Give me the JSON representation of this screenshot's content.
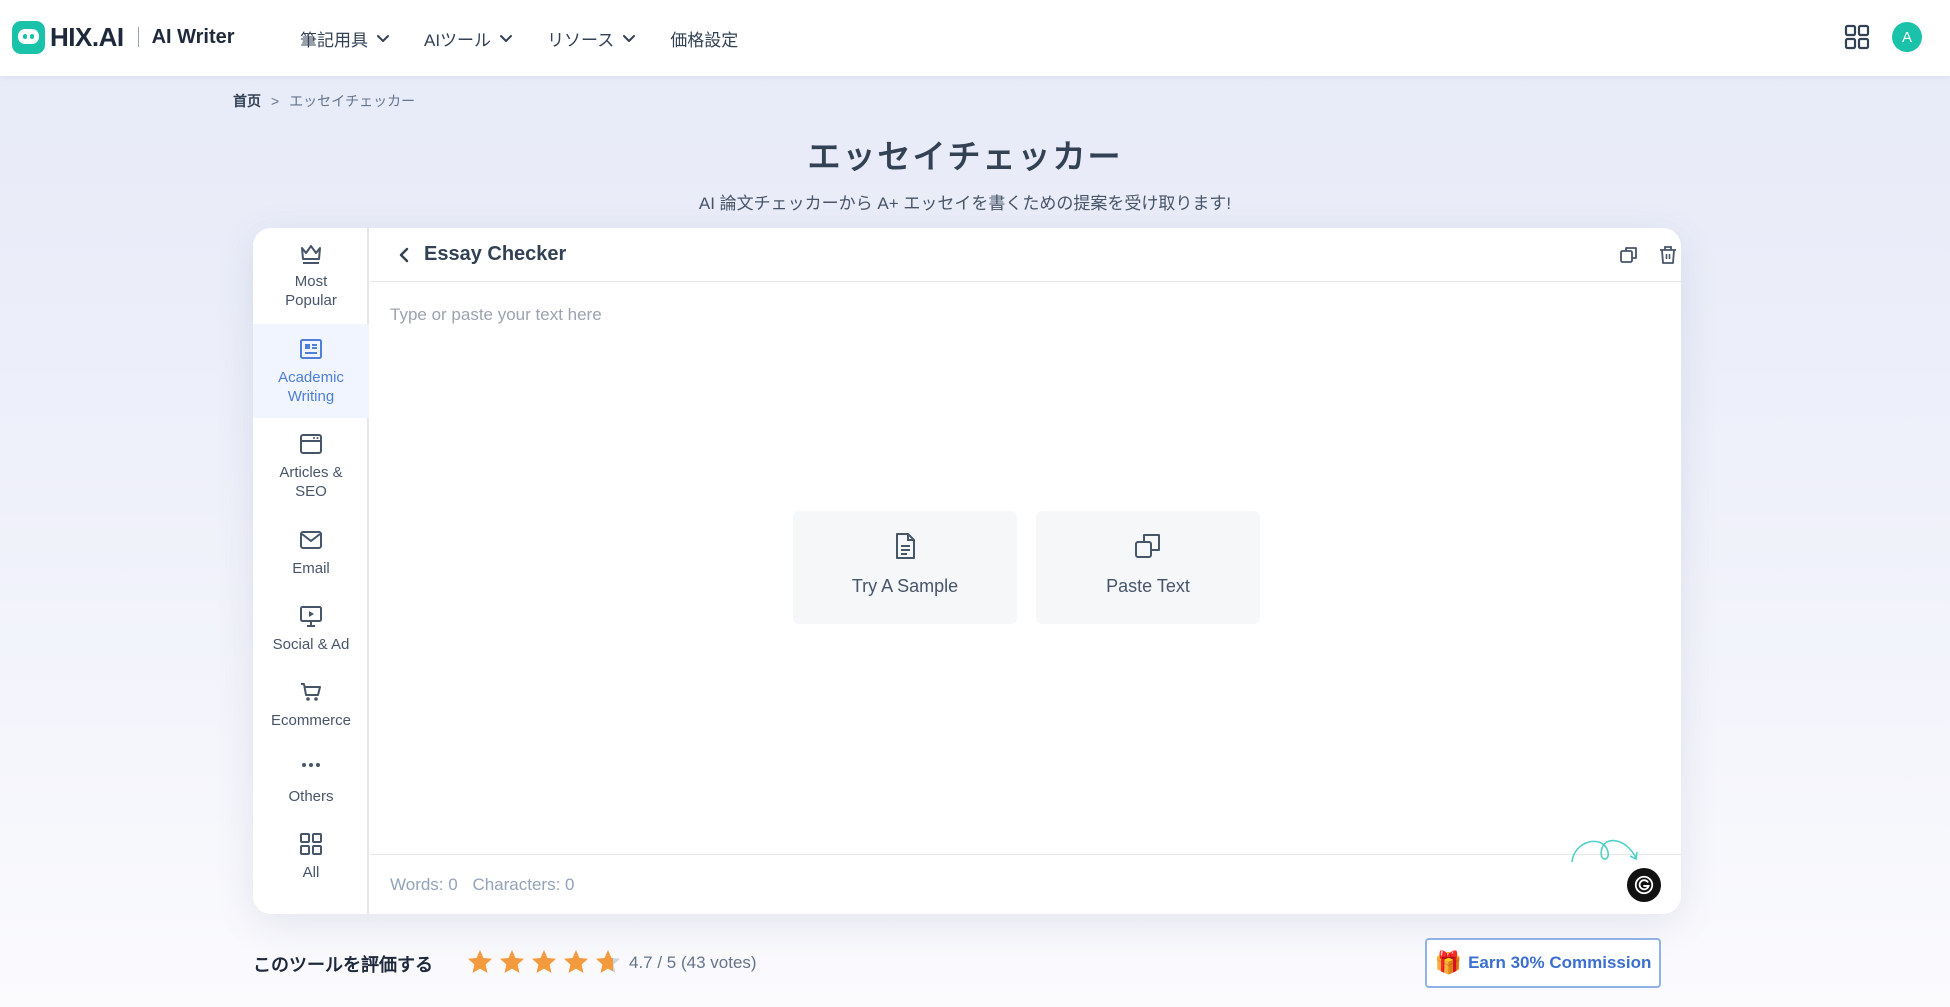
{
  "header": {
    "logo_text": "HIX.AI",
    "logo_sub": "AI Writer",
    "nav": [
      {
        "label": "筆記用具",
        "dropdown": true
      },
      {
        "label": "AIツール",
        "dropdown": true
      },
      {
        "label": "リソース",
        "dropdown": true
      },
      {
        "label": "価格設定",
        "dropdown": false
      }
    ],
    "avatar_letter": "A"
  },
  "breadcrumb": {
    "home": "首页",
    "separator": ">",
    "current": "エッセイチェッカー"
  },
  "page": {
    "title": "エッセイチェッカー",
    "subtitle": "AI 論文チェッカーから A+ エッセイを書くための提案を受け取ります!"
  },
  "sidebar": {
    "items": [
      {
        "label": "Most Popular",
        "icon": "crown-icon",
        "active": false
      },
      {
        "label": "Academic Writing",
        "icon": "newspaper-icon",
        "active": true
      },
      {
        "label": "Articles & SEO",
        "icon": "browser-window-icon",
        "active": false
      },
      {
        "label": "Email",
        "icon": "envelope-icon",
        "active": false
      },
      {
        "label": "Social & Ad",
        "icon": "presentation-icon",
        "active": false
      },
      {
        "label": "Ecommerce",
        "icon": "cart-icon",
        "active": false
      },
      {
        "label": "Others",
        "icon": "more-dots-icon",
        "active": false
      },
      {
        "label": "All",
        "icon": "grid-icon",
        "active": false
      }
    ]
  },
  "panel": {
    "title": "Essay Checker",
    "placeholder": "Type or paste your text here",
    "try_sample": "Try A Sample",
    "paste_text": "Paste Text",
    "words_label": "Words: 0",
    "chars_label": "Characters: 0"
  },
  "rating": {
    "title": "このツールを評価する",
    "stars": 4.7,
    "score_text": "4.7 / 5 (43 votes)"
  },
  "earn": {
    "label": "Earn 30% Commission"
  },
  "colors": {
    "brand": "#19c2a8",
    "accent_blue": "#4f7fd9",
    "star": "#f59a3c"
  }
}
